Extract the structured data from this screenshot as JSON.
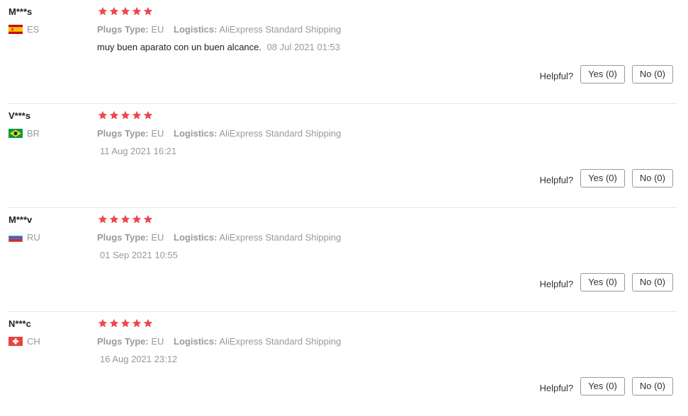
{
  "colors": {
    "star": "#f0464e",
    "muted_text": "#999999",
    "body_text": "#222222",
    "divider": "#e6e6e6",
    "button_border": "#999999"
  },
  "reviews": [
    {
      "buyer": "M***s",
      "country": "ES",
      "flag_icon": "spain-flag-icon",
      "rating": 5,
      "plugs_label": "Plugs Type:",
      "plugs_value": "EU",
      "logistics_label": "Logistics:",
      "logistics_value": "AliExpress Standard Shipping",
      "text": "muy buen aparato con un buen alcance.",
      "date": "08 Jul 2021 01:53",
      "helpful_label": "Helpful?",
      "yes_label": "Yes (0)",
      "no_label": "No (0)"
    },
    {
      "buyer": "V***s",
      "country": "BR",
      "flag_icon": "brazil-flag-icon",
      "rating": 5,
      "plugs_label": "Plugs Type:",
      "plugs_value": "EU",
      "logistics_label": "Logistics:",
      "logistics_value": "AliExpress Standard Shipping",
      "text": "",
      "date": "11 Aug 2021 16:21",
      "helpful_label": "Helpful?",
      "yes_label": "Yes (0)",
      "no_label": "No (0)"
    },
    {
      "buyer": "M***v",
      "country": "RU",
      "flag_icon": "russia-flag-icon",
      "rating": 5,
      "plugs_label": "Plugs Type:",
      "plugs_value": "EU",
      "logistics_label": "Logistics:",
      "logistics_value": "AliExpress Standard Shipping",
      "text": "",
      "date": "01 Sep 2021 10:55",
      "helpful_label": "Helpful?",
      "yes_label": "Yes (0)",
      "no_label": "No (0)"
    },
    {
      "buyer": "N***c",
      "country": "CH",
      "flag_icon": "switzerland-flag-icon",
      "rating": 5,
      "plugs_label": "Plugs Type:",
      "plugs_value": "EU",
      "logistics_label": "Logistics:",
      "logistics_value": "AliExpress Standard Shipping",
      "text": "",
      "date": "16 Aug 2021 23:12",
      "helpful_label": "Helpful?",
      "yes_label": "Yes (0)",
      "no_label": "No (0)"
    }
  ]
}
